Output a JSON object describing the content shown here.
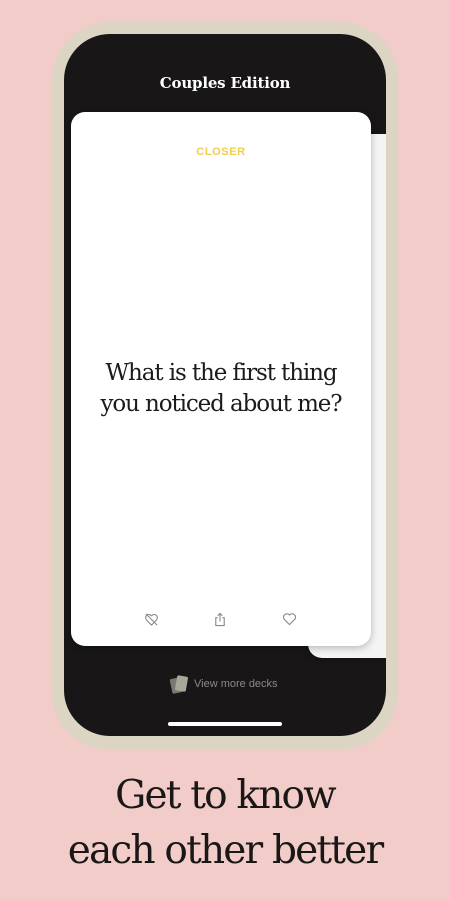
{
  "app": {
    "screen_title": "Couples Edition"
  },
  "card": {
    "category": "CLOSER",
    "question": "What is the first thing you noticed about me?"
  },
  "actions": {
    "dislike_icon": "heart-slash-icon",
    "share_icon": "share-icon",
    "like_icon": "heart-icon"
  },
  "footer": {
    "view_more_label": "View more decks",
    "view_more_icon": "cards-stack-icon"
  },
  "caption": {
    "line1": "Get to know",
    "line2": "each other better"
  },
  "colors": {
    "background": "#f2ccc9",
    "phone_frame": "#dcd5c3",
    "screen": "#181616",
    "category_accent": "#f0cf4a",
    "card": "#ffffff"
  }
}
